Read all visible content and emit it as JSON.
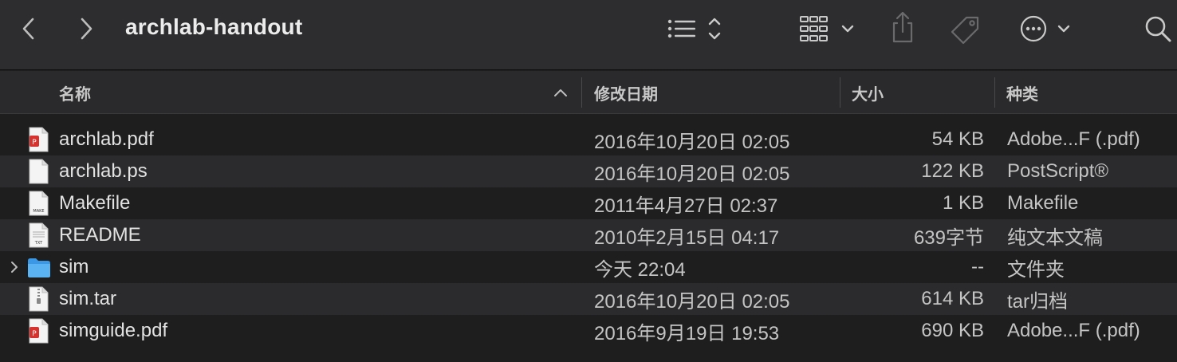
{
  "window": {
    "title": "archlab-handout"
  },
  "toolbar": {
    "back_icon": "chevron-left-icon",
    "forward_icon": "chevron-right-icon",
    "view_icon": "list-view-icon",
    "group_icon": "group-grid-icon",
    "share_icon": "share-icon",
    "tag_icon": "tag-icon",
    "more_icon": "ellipsis-circle-icon",
    "search_icon": "search-icon"
  },
  "columns": {
    "name": "名称",
    "date": "修改日期",
    "size": "大小",
    "kind": "种类"
  },
  "files": [
    {
      "name": "archlab.pdf",
      "date": "2016年10月20日 02:05",
      "size": "54 KB",
      "kind": "Adobe...F (.pdf)",
      "icon": "pdf-file-icon",
      "alt": false
    },
    {
      "name": "archlab.ps",
      "date": "2016年10月20日 02:05",
      "size": "122 KB",
      "kind": "PostScript®",
      "icon": "document-file-icon",
      "alt": true
    },
    {
      "name": "Makefile",
      "date": "2011年4月27日 02:37",
      "size": "1 KB",
      "kind": "Makefile",
      "icon": "makefile-icon",
      "alt": false,
      "badge": "MAKE"
    },
    {
      "name": "README",
      "date": "2010年2月15日 04:17",
      "size": "639字节",
      "kind": "纯文本文稿",
      "icon": "text-file-icon",
      "alt": true,
      "badge": "TXT"
    },
    {
      "name": "sim",
      "date": "今天 22:04",
      "size": "--",
      "kind": "文件夹",
      "icon": "folder-icon",
      "alt": false,
      "folder": true
    },
    {
      "name": "sim.tar",
      "date": "2016年10月20日 02:05",
      "size": "614 KB",
      "kind": "tar归档",
      "icon": "archive-file-icon",
      "alt": true
    },
    {
      "name": "simguide.pdf",
      "date": "2016年9月19日 19:53",
      "size": "690 KB",
      "kind": "Adobe...F (.pdf)",
      "icon": "pdf-file-icon",
      "alt": false
    }
  ],
  "colors": {
    "pdf_red": "#d8322e",
    "folder_blue": "#3a98e6"
  }
}
